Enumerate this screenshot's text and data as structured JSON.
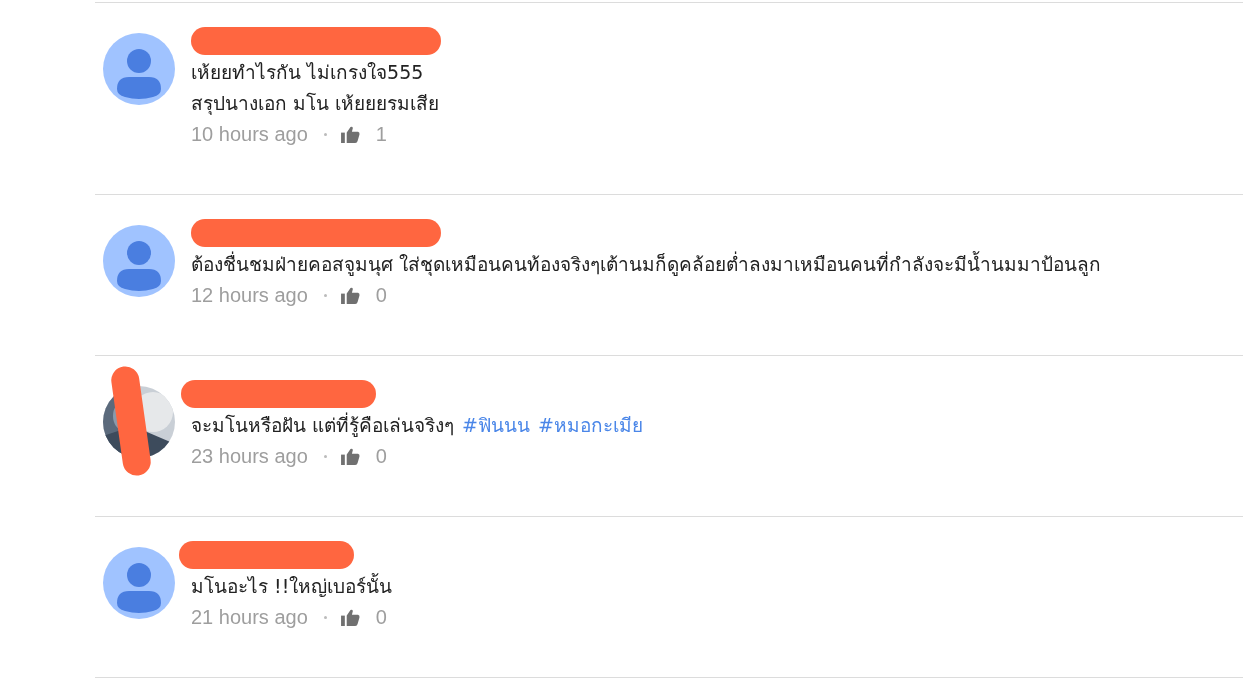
{
  "comments": [
    {
      "avatar": {
        "kind": "default",
        "hidden": false
      },
      "name_hidden": true,
      "lines": [
        "เห้ยยทำไรกัน ไม่เกรงใจ555",
        "สรุปนางเอก มโน เห้ยยยรมเสีย"
      ],
      "time": "10 hours ago",
      "likes": "1"
    },
    {
      "avatar": {
        "kind": "default",
        "hidden": false
      },
      "name_hidden": true,
      "lines": [
        "ต้องชื่นชมฝ่ายคอสจูมนุศ ใส่ชุดเหมือนคนท้องจริงๆเต้านมก็ดูคล้อยต่ำลงมาเหมือนคนที่กำลังจะมีน้ำนมมาป้อนลูก"
      ],
      "time": "12 hours ago",
      "likes": "0"
    },
    {
      "avatar": {
        "kind": "picture",
        "hidden": true
      },
      "name_hidden": true,
      "lines": [
        "จะมโนหรือฝัน แต่ที่รู้คือเล่นจริงๆ"
      ],
      "hashtags": [
        "#ฟินนน",
        "#หมอกะเมีย"
      ],
      "time": "23 hours ago",
      "likes": "0"
    },
    {
      "avatar": {
        "kind": "default",
        "hidden": false
      },
      "name_hidden": true,
      "lines": [
        "มโนอะไร !!ใหญ่เบอร์นั้น"
      ],
      "time": "21 hours ago",
      "likes": "0"
    }
  ]
}
